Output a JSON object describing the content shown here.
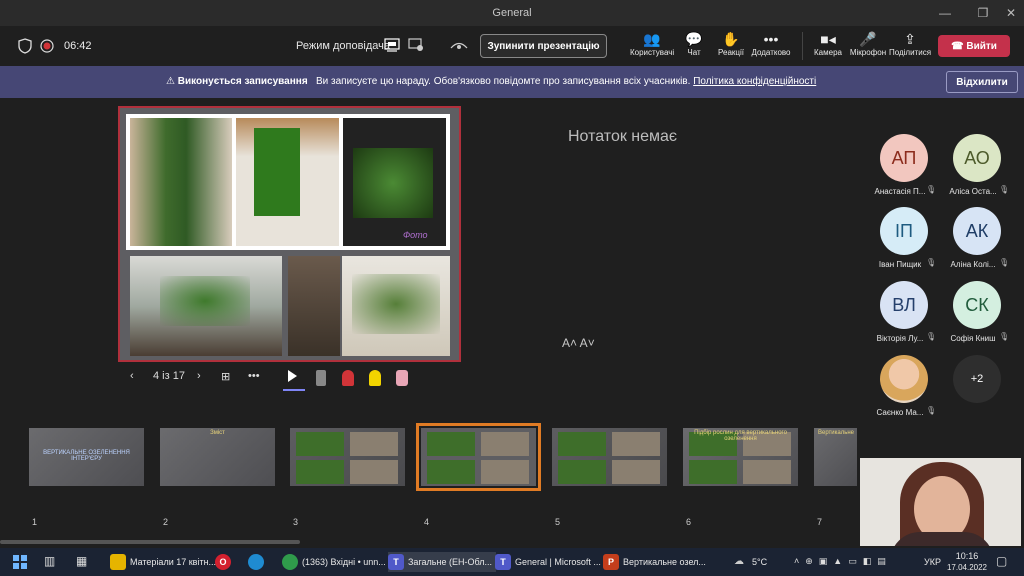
{
  "window": {
    "title": "General"
  },
  "toolbar": {
    "timer": "06:42",
    "presenter_mode_label": "Режим доповідача",
    "stop_presenting_label": "Зупинити презентацію",
    "items": [
      {
        "label": "Користувачі",
        "icon": "people-icon"
      },
      {
        "label": "Чат",
        "icon": "chat-icon"
      },
      {
        "label": "Реакції",
        "icon": "reactions-icon"
      },
      {
        "label": "Додатково",
        "icon": "more-icon"
      },
      {
        "label": "Камера",
        "icon": "camera-icon"
      },
      {
        "label": "Мікрофон",
        "icon": "microphone-icon"
      },
      {
        "label": "Поділитися",
        "icon": "share-icon"
      }
    ],
    "leave_label": "Вийти"
  },
  "banner": {
    "title": "Виконується записування",
    "message": "Ви записуєте цю нараду. Обов'язково повідомте про записування всіх учасників.",
    "link": "Політика конфіденційності",
    "dismiss_label": "Відхилити"
  },
  "slide": {
    "watermark": "Фото",
    "counter": "4 із 17"
  },
  "notes": {
    "empty_text": "Нотаток немає",
    "font_controls": "A˄ A˅"
  },
  "participants": [
    {
      "initials": "АП",
      "name": "Анастасія П...",
      "color": "#f2c7bf",
      "text_color": "#8c2c1d"
    },
    {
      "initials": "АО",
      "name": "Аліса Оста...",
      "color": "#dbe6c5",
      "text_color": "#4c5a2a"
    },
    {
      "initials": "ІП",
      "name": "Іван Пищик",
      "color": "#d6ecf7",
      "text_color": "#1e5b80"
    },
    {
      "initials": "АК",
      "name": "Аліна Колі...",
      "color": "#d7e4f5",
      "text_color": "#1f3d66"
    },
    {
      "initials": "ВЛ",
      "name": "Вікторія Лу...",
      "color": "#d9e3f4",
      "text_color": "#253f6b"
    },
    {
      "initials": "СК",
      "name": "Софія Книш",
      "color": "#d4efe0",
      "text_color": "#215c3c"
    },
    {
      "initials": "",
      "name": "Саєнко Ма...",
      "color": "#e8d6c2",
      "text_color": "#333"
    }
  ],
  "more_participants": "+2",
  "thumbnails": [
    {
      "num": "1",
      "title": "ВЕРТИКАЛЬНЕ ОЗЕЛЕНЕННЯ ІНТЕР'ЄРУ"
    },
    {
      "num": "2",
      "title": "Зміст"
    },
    {
      "num": "3",
      "title": ""
    },
    {
      "num": "4",
      "title": ""
    },
    {
      "num": "5",
      "title": ""
    },
    {
      "num": "6",
      "title": "Підбір рослин для вертикального озеленення"
    },
    {
      "num": "7",
      "title": "Вертикальне"
    }
  ],
  "taskbar": {
    "items": [
      {
        "label": "Матеріали 17 квітн...",
        "icon": "folder-icon",
        "color": "#e6b400"
      },
      {
        "label": "",
        "icon": "opera-icon",
        "color": "#d3202f"
      },
      {
        "label": "",
        "icon": "edge-icon",
        "color": "#1f8bd1"
      },
      {
        "label": "(1363) Вхідні • unn...",
        "icon": "chrome-icon",
        "color": "#2f9b4b"
      },
      {
        "label": "Загальне (ЕН-Обл...",
        "icon": "teams-icon",
        "color": "#5059c9"
      },
      {
        "label": "General | Microsoft ...",
        "icon": "teams-icon",
        "color": "#5059c9"
      },
      {
        "label": "Вертикальне озел...",
        "icon": "powerpoint-icon",
        "color": "#c43e1c"
      }
    ],
    "weather": "5°C",
    "lang": "УКР",
    "time": "10:16",
    "date": "17.04.2022"
  }
}
